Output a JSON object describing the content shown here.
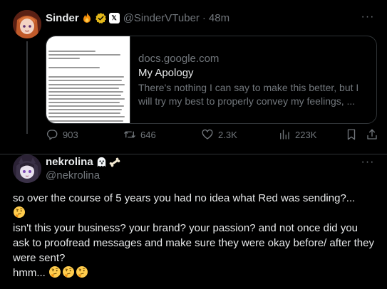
{
  "tweet1": {
    "author_name": "Sinder",
    "author_handle": "@SinderVTuber",
    "separator": "·",
    "time": "48m",
    "more_label": "···",
    "card": {
      "domain": "docs.google.com",
      "title": "My Apology",
      "description": "There's nothing I can say to make this better, but I will try my best to properly convey my feelings, ..."
    },
    "stats": {
      "replies": "903",
      "reposts": "646",
      "likes": "2.3K",
      "views": "223K"
    }
  },
  "tweet2": {
    "author_name": "nekrolina",
    "author_handle": "@nekrolina",
    "more_label": "···",
    "text_lines": [
      "so over the course of 5 years you had no idea what Red was sending?...",
      "isn't this your business? your brand? your passion? and not once did you ask to proofread messages and make sure they were okay before/ after they were sent?",
      "hmm..."
    ]
  },
  "icons": {
    "affiliate_badge_glyph": "𝕏",
    "verified_color": "#e2b719",
    "accent_blue": "#1d9bf0"
  }
}
